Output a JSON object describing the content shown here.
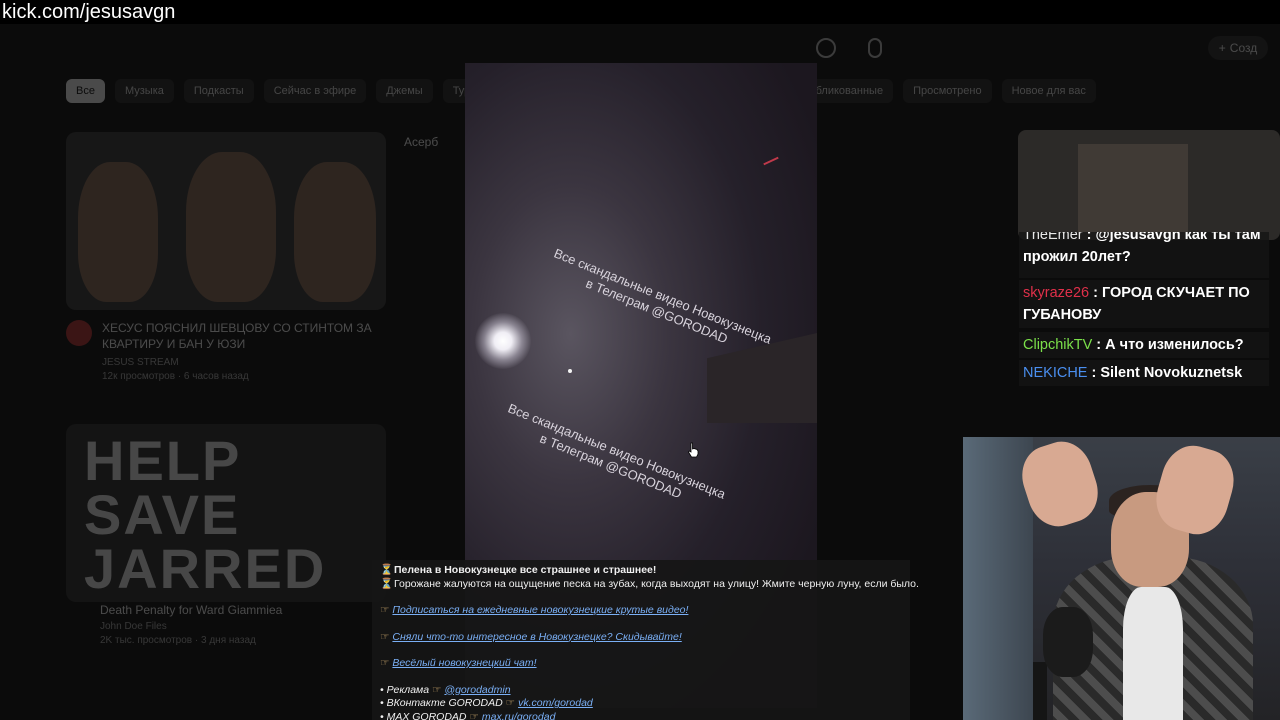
{
  "watermark": "kick.com/jesusavgn",
  "youtube": {
    "chips_left": [
      "Все",
      "Музыка",
      "Подкасты",
      "Сейчас в эфире",
      "Джемы",
      "Тури"
    ],
    "chips_right": [
      "убликованные",
      "Просмотрено",
      "Новое для вас"
    ],
    "create_label": "Созд",
    "videos": [
      {
        "title": "ХЕСУС ПОЯСНИЛ ШЕВЦОВУ СО СТИНТОМ ЗА КВАРТИРУ И БАН У ЮЗИ",
        "channel": "JESUS STREAM",
        "meta": "12к просмотров · 6 часов назад"
      },
      {
        "title": "Death Penalty for Ward Giammiea",
        "channel": "John Doe Files",
        "meta": "2K тыс. просмотров · 3 дня назад"
      }
    ],
    "side_label": "Асерб"
  },
  "player": {
    "overlay_text_1": "Все скандальные видео Новокузнецка\nв Телеграм @GORODAD",
    "overlay_text_2": "Все скандальные видео Новокузнецка\nв Телеграм @GORODAD"
  },
  "description": {
    "line1": "Пелена в Новокузнецке все страшнее и страшнее!",
    "line2": "Горожане жалуются на ощущение песка на зубах, когда выходят на улицу! Жмите черную луну, если было.",
    "link1": "Подписаться на ежедневные новокузнецкие крутые видео!",
    "link2": "Сняли что-то интересное в Новокузнецке? Скидывайте!",
    "link3": "Весёлый новокузнецкий чат!",
    "ad_label": "• Реклама",
    "ad_handle": "@gorodadmin",
    "vk_label": "• ВКонтакте GORODAD",
    "vk_link": "vk.com/gorodad",
    "max_label": "• MAX GORODAD",
    "max_link": "max.ru/gorodad"
  },
  "chat": [
    {
      "user": "TheEmer",
      "message": ": @jesusavgn как ты там прожил 20лет?",
      "color": "#e8e8e8"
    },
    {
      "user": "skyraze26",
      "message": ": ГОРОД СКУЧАЕТ ПО ГУБАНОВУ",
      "color": "#e0304a"
    },
    {
      "user": "ClipchikTV",
      "message": ": А что изменилось?",
      "color": "#7be04a"
    },
    {
      "user": "NEKICHE",
      "message": ": Silent Novokuznetsk",
      "color": "#4a8ff0"
    }
  ]
}
